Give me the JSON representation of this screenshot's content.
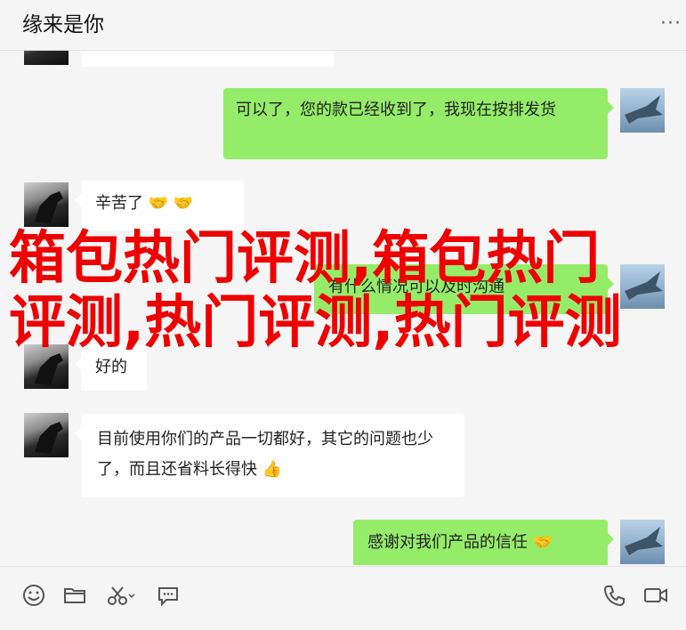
{
  "header": {
    "title": "缘来是你",
    "more_label": "···"
  },
  "messages": [
    {
      "side": "in",
      "text": ""
    },
    {
      "side": "out",
      "text": "可以了，您的款已经收到了，我现在按排发货"
    },
    {
      "side": "in",
      "text": "辛苦了",
      "emoji": "🤝 🤝"
    },
    {
      "side": "out",
      "text": "有什么情况可以及时沟通"
    },
    {
      "side": "in",
      "text": "好的"
    },
    {
      "side": "in",
      "text": "目前使用你们的产品一切都好，其它的问题也少了，而且还省料长得快",
      "emoji": "👍"
    },
    {
      "side": "out",
      "text": "感谢对我们产品的信任",
      "emoji": "🤝"
    }
  ],
  "overlay": {
    "text": "箱包热门评测,箱包热门评测,热门评测,热门评测"
  },
  "toolbar": {
    "icons": [
      "emoji-icon",
      "folder-icon",
      "scissors-icon",
      "chat-bubble-icon",
      "phone-icon",
      "video-icon"
    ]
  }
}
